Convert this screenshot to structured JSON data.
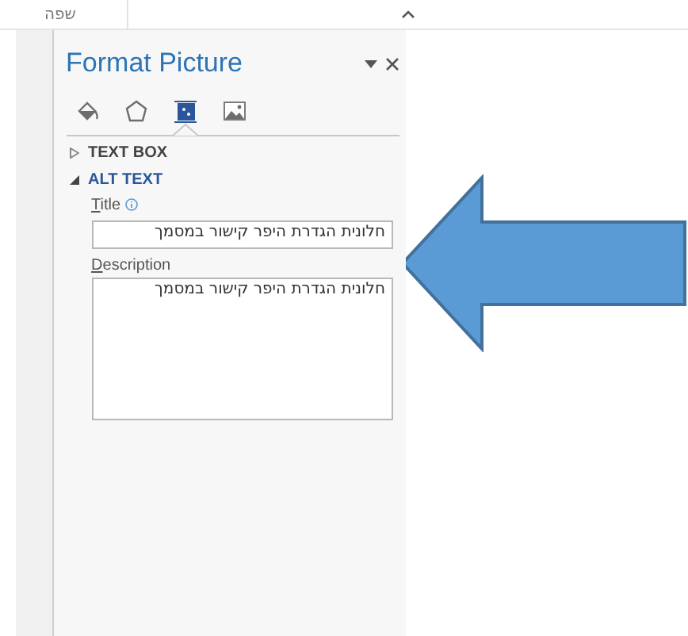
{
  "ribbon": {
    "group_label": "שפה"
  },
  "pane": {
    "title": "Format Picture",
    "tabs": [
      {
        "kind": "fill",
        "selected": false
      },
      {
        "kind": "shape",
        "selected": false
      },
      {
        "kind": "layout",
        "selected": true
      },
      {
        "kind": "picture",
        "selected": false
      }
    ],
    "sections": [
      {
        "label": "TEXT BOX",
        "expanded": false
      },
      {
        "label": "ALT TEXT",
        "expanded": true,
        "title_label": "Title",
        "title_value": "חלונית הגדרת היפר קישור במסמך",
        "description_label": "Description",
        "description_value": "חלונית הגדרת היפר קישור במסמך"
      }
    ]
  }
}
